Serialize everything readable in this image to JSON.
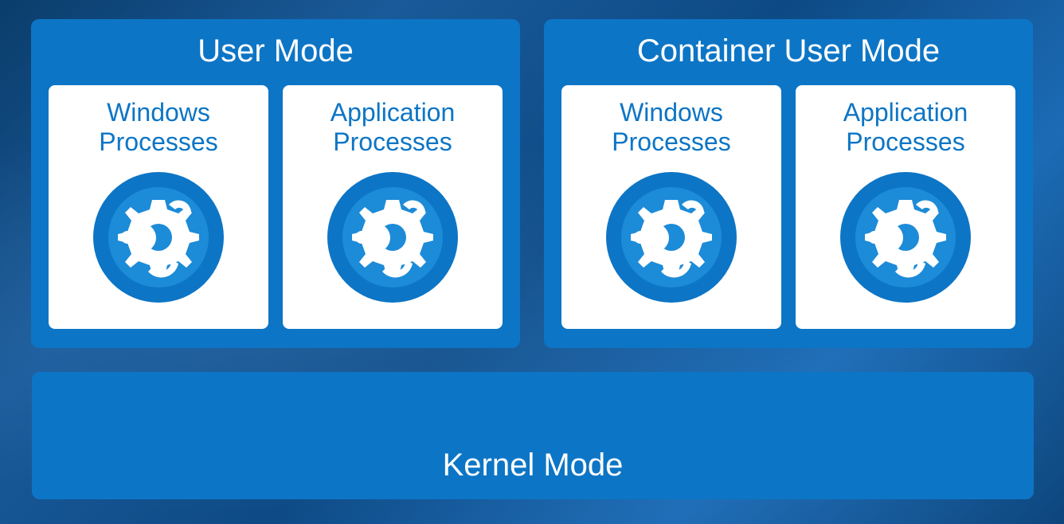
{
  "userMode": {
    "title": "User Mode",
    "processes": [
      {
        "label": "Windows\nProcesses"
      },
      {
        "label": "Application\nProcesses"
      }
    ]
  },
  "containerUserMode": {
    "title": "Container User Mode",
    "processes": [
      {
        "label": "Windows\nProcesses"
      },
      {
        "label": "Application\nProcesses"
      }
    ]
  },
  "kernelMode": {
    "title": "Kernel Mode"
  },
  "colors": {
    "panelBlue": "#0d75c5",
    "cardWhite": "#ffffff"
  }
}
